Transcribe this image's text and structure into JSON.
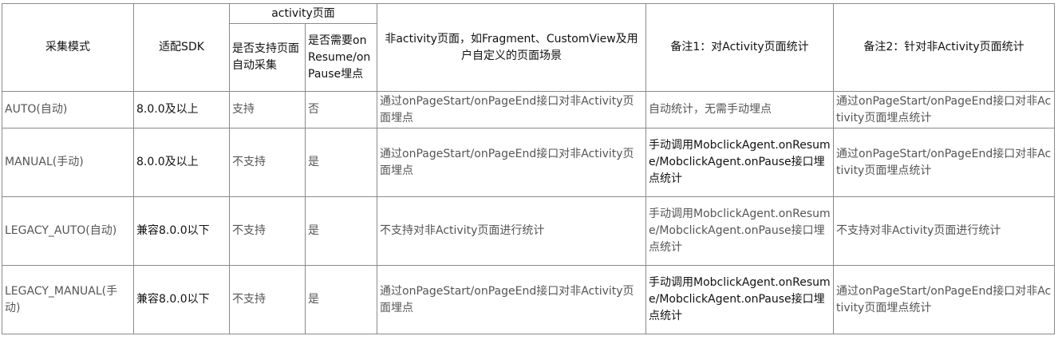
{
  "headers": {
    "mode": "采集模式",
    "sdk": "适配SDK",
    "activity_group": "activity页面",
    "auto_collect": "是否支持页面自动采集",
    "need_manual": "是否需要onResume/onPause埋点",
    "non_activity": "非activity页面，如Fragment、CustomView及用户自定义的页面场景",
    "note1": "备注1：对Activity页面统计",
    "note2": "备注2：针对非Activity页面统计"
  },
  "rows": [
    {
      "mode": "AUTO(自动)",
      "sdk": "8.0.0及以上",
      "auto_collect": "支持",
      "need_manual": "否",
      "non_activity": "通过onPageStart/onPageEnd接口对非Activity页面埋点",
      "note1": "自动统计，无需手动埋点",
      "note2": "通过onPageStart/onPageEnd接口对非Activity页面埋点统计"
    },
    {
      "mode": "MANUAL(手动)",
      "sdk": "8.0.0及以上",
      "auto_collect": "不支持",
      "need_manual": "是",
      "non_activity": "通过onPageStart/onPageEnd接口对非Activity页面埋点",
      "note1": "手动调用MobclickAgent.onResume/MobclickAgent.onPause接口埋点统计",
      "note2": "通过onPageStart/onPageEnd接口对非Activity页面埋点统计"
    },
    {
      "mode": "LEGACY_AUTO(自动)",
      "sdk": "兼容8.0.0以下",
      "auto_collect": "不支持",
      "need_manual": "是",
      "non_activity": "不支持对非Activity页面进行统计",
      "note1": "手动调用MobclickAgent.onResume/MobclickAgent.onPause接口埋点统计",
      "note2": "不支持对非Activity页面进行统计"
    },
    {
      "mode": "LEGACY_MANUAL(手动)",
      "sdk": "兼容8.0.0以下",
      "auto_collect": "不支持",
      "need_manual": "是",
      "non_activity": "通过onPageStart/onPageEnd接口对非Activity页面埋点",
      "note1": "手动调用MobclickAgent.onResume/MobclickAgent.onPause接口埋点统计",
      "note2": "通过onPageStart/onPageEnd接口对非Activity页面埋点统计"
    }
  ]
}
